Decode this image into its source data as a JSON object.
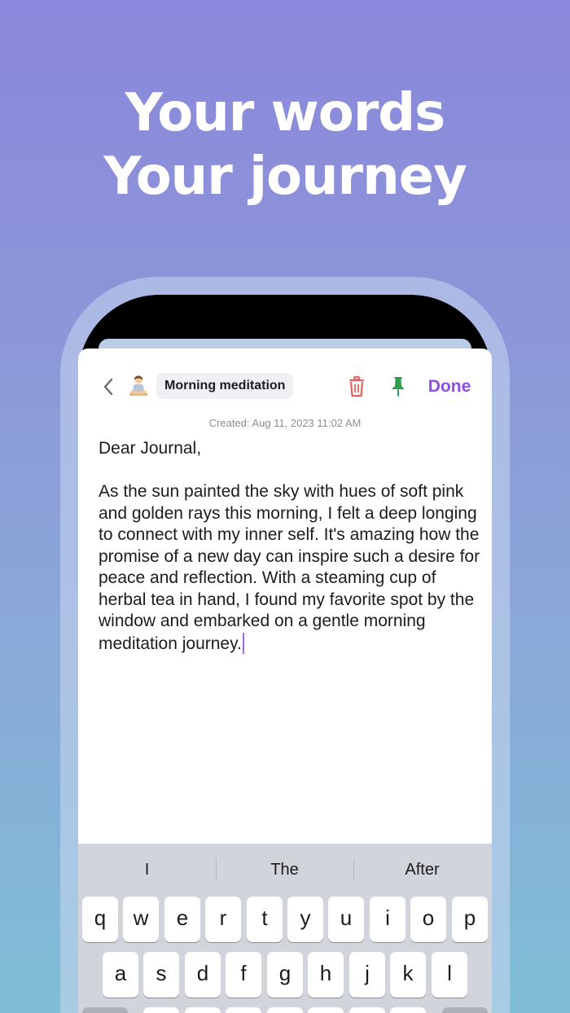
{
  "headline": {
    "line1": "Your words",
    "line2": "Your journey"
  },
  "entry": {
    "title": "Morning meditation",
    "created": "Created: Aug 11, 2023 11:02 AM",
    "greeting": "Dear Journal,",
    "paragraph": "As the sun painted the sky with hues of soft pink and golden rays this morning, I felt a deep longing to connect with my inner self. It's amazing how the promise of a new day can inspire such a desire for peace and reflection. With a steaming cup of herbal tea in hand, I found my favorite spot by the window and embarked on a gentle morning meditation journey."
  },
  "toolbar": {
    "done_label": "Done"
  },
  "icons": {
    "back": "chevron-left-icon",
    "mood": "meditation-person-icon",
    "delete": "trash-icon",
    "pin": "pin-icon"
  },
  "colors": {
    "accent": "#8d4fe0",
    "delete": "#e8605f",
    "pin": "#2e9e4f"
  },
  "keyboard": {
    "suggestions": [
      "I",
      "The",
      "After"
    ],
    "row1": [
      "q",
      "w",
      "e",
      "r",
      "t",
      "y",
      "u",
      "i",
      "o",
      "p"
    ],
    "row2": [
      "a",
      "s",
      "d",
      "f",
      "g",
      "h",
      "j",
      "k",
      "l"
    ]
  }
}
